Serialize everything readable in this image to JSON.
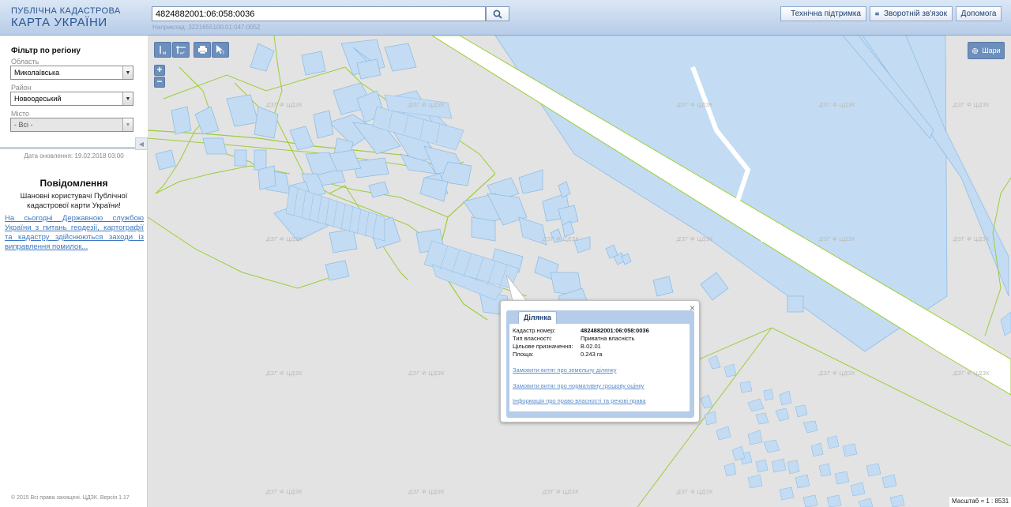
{
  "header": {
    "logo_line1": "ПУБЛІЧНА КАДАСТРОВА",
    "logo_line2": "КАРТА УКРАЇНИ",
    "search_value": "4824882001:06:058:0036",
    "search_hint": "Наприклад: 3221655100:01:047:0052",
    "support_label": "Технічна підтримка",
    "feedback_label": "Зворотній зв'язок",
    "help_label": "Допомога"
  },
  "sidebar": {
    "filter_title": "Фільтр по регіону",
    "region_label": "Область",
    "region_value": "Миколаївська",
    "district_label": "Район",
    "district_value": "Новоодеський",
    "city_label": "Місто",
    "city_value": "- Всі -",
    "update_date": "Дата оновлення: 19.02.2018 03:00",
    "notice_title": "Повідомлення",
    "notice_greeting": "Шановні користувачі Публічної кадастрової карти України!",
    "notice_body": "На сьогодні Державною службою України з питань геодезії, картографії та кадастру здійснюються заходи із виправлення помилок...",
    "copyright": "© 2015 Всі права захищені. ЦДЗК. Версія 1.17"
  },
  "map": {
    "layers_label": "Шари",
    "scale_label": "Масштаб = 1 : 8531",
    "watermark": "ДЗГ Ф ЦДЗК",
    "colors": {
      "map_bg": "#e3e3e3",
      "parcel_fill": "#c3dcf3",
      "parcel_stroke": "#8fbde6",
      "boundary": "#9ccd3a",
      "tool_blue": "#6d8fbd"
    }
  },
  "popup": {
    "tab_label": "Ділянка",
    "rows": [
      {
        "key": "Кадастр.номер:",
        "value": "4824882001:06:058:0036"
      },
      {
        "key": "Тип власності:",
        "value": "Приватна власність"
      },
      {
        "key": "Цільове призначення:",
        "value": "В.02.01"
      },
      {
        "key": "Площа:",
        "value": "0.243 га"
      }
    ],
    "links": [
      "Замовити витяг про земельну ділянку",
      "Замовити витяг про нормативну грошову оцінку",
      "Інформація про право власності та речові права"
    ]
  }
}
